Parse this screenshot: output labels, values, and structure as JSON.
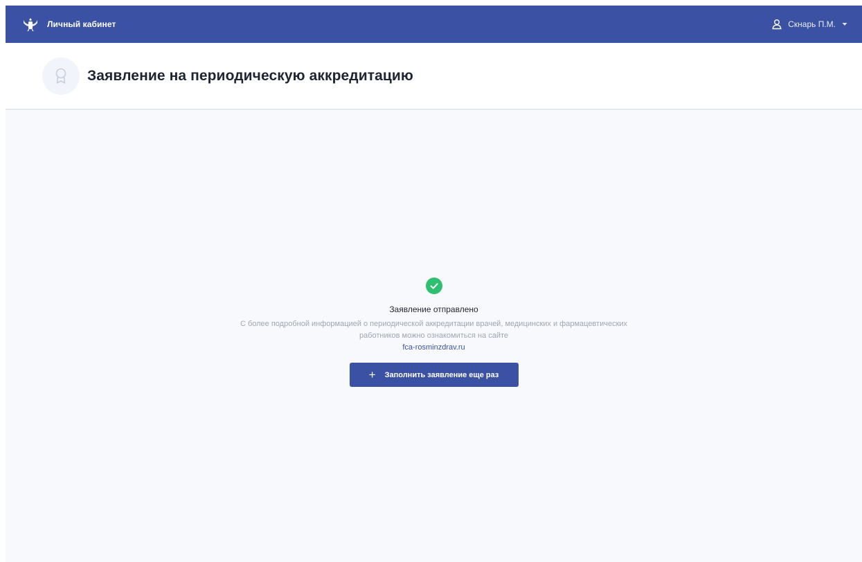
{
  "header": {
    "brand_title": "Личный кабинет",
    "emblem_icon": "coat-of-arms-icon",
    "user": {
      "name": "Скнарь П.М.",
      "icon": "user-icon",
      "caret": "caret-down-icon"
    }
  },
  "page": {
    "title": "Заявление на периодическую аккредитацию",
    "badge_icon": "award-medal-icon"
  },
  "result": {
    "icon": "check-circle-icon",
    "title": "Заявление отправлено",
    "description": "С более подробной информацией о периодической аккредитации врачей, медицинских и фармацевтических работников можно ознакомиться на сайте",
    "link": "fca-rosminzdrav.ru",
    "button_label": "Заполнить заявление еще раз",
    "button_icon": "plus-icon"
  },
  "colors": {
    "primary": "#3b51a3",
    "success": "#2fbf71",
    "background": "#f8f9fc"
  }
}
